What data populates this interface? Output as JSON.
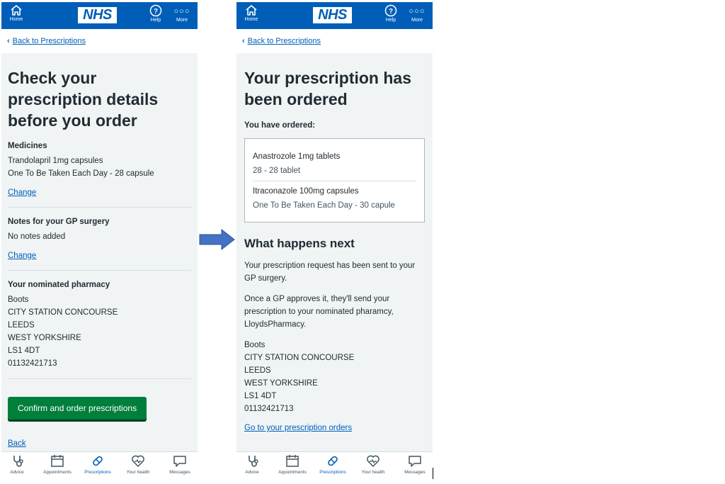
{
  "header": {
    "home_label": "Home",
    "logo": "NHS",
    "help_label": "Help",
    "more_label": "More"
  },
  "nav": {
    "advice": "Advice",
    "appointments": "Appointments",
    "prescriptions": "Prescriptions",
    "your_health": "Your health",
    "messages": "Messages"
  },
  "back_link": "Back to Prescriptions",
  "left": {
    "title": "Check your prescription details before you order",
    "medicines_heading": "Medicines",
    "medicine_name": "Trandolapril 1mg capsules",
    "medicine_dosage": "One To Be Taken Each Day - 28 capsule",
    "change_1": "Change",
    "notes_heading": "Notes for your GP surgery",
    "notes_value": "No notes added",
    "change_2": "Change",
    "pharmacy_heading": "Your nominated pharmacy",
    "pharmacy": [
      "Boots",
      "CITY STATION CONCOURSE",
      "LEEDS",
      "WEST YORKSHIRE",
      "LS1 4DT",
      "01132421713"
    ],
    "confirm_button": "Confirm and order prescriptions",
    "back": "Back"
  },
  "right": {
    "title": "Your prescription has been ordered",
    "ordered_heading": "You have ordered:",
    "items": [
      {
        "name": "Anastrozole 1mg tablets",
        "detail": "28 - 28 tablet"
      },
      {
        "name": "Itraconazole 100mg capsules",
        "detail": "One To Be Taken Each Day - 30 capule"
      }
    ],
    "next_heading": "What happens next",
    "paragraph1": "Your prescription request has been sent to your GP surgery.",
    "paragraph2": "Once a GP approves it, they'll send your prescription to your nominated pharamcy, LloydsPharmacy.",
    "pharmacy": [
      "Boots",
      "CITY STATION CONCOURSE",
      "LEEDS",
      "WEST YORKSHIRE",
      "LS1 4DT",
      "01132421713"
    ],
    "orders_link": "Go to your prescription orders"
  },
  "colors": {
    "nhs_blue": "#005eb8",
    "nhs_green": "#007f3b",
    "background": "#f0f4f5",
    "text": "#212b32",
    "arrow": "#4472c4"
  }
}
